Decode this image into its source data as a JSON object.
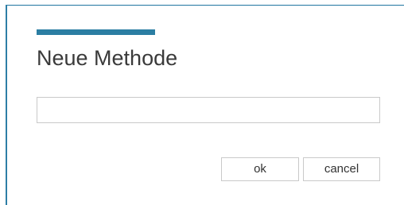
{
  "dialog": {
    "title": "Neue Methode",
    "name_input": {
      "value": "",
      "placeholder": ""
    },
    "buttons": {
      "ok_label": "ok",
      "cancel_label": "cancel"
    }
  },
  "colors": {
    "accent": "#2b7ea3",
    "frame": "#2d7ea6",
    "title_text": "#3a3a3a",
    "border": "#c9c9c9"
  }
}
